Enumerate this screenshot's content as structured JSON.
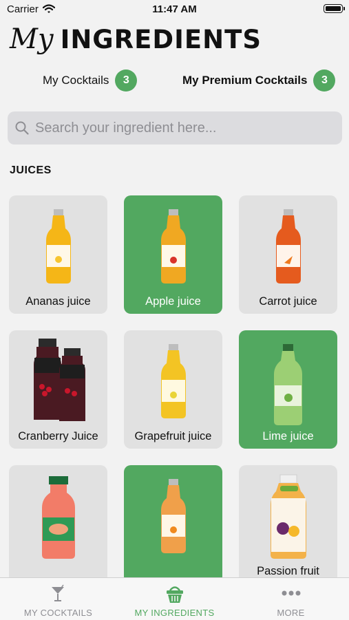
{
  "status_bar": {
    "carrier": "Carrier",
    "time": "11:47 AM"
  },
  "header": {
    "title_script": "My",
    "title_main": "INGREDIENTS"
  },
  "counters": [
    {
      "label": "My Cocktails",
      "count": "3"
    },
    {
      "label": "My Premium Cocktails",
      "count": "3"
    }
  ],
  "search": {
    "placeholder": "Search your ingredient here...",
    "value": ""
  },
  "section_title": "JUICES",
  "ingredients": [
    {
      "name": "Ananas juice",
      "selected": false
    },
    {
      "name": "Apple juice",
      "selected": true
    },
    {
      "name": "Carrot juice",
      "selected": false
    },
    {
      "name": "Cranberry Juice",
      "selected": false
    },
    {
      "name": "Grapefruit juice",
      "selected": false
    },
    {
      "name": "Lime juice",
      "selected": true
    },
    {
      "name": "",
      "selected": false
    },
    {
      "name": "",
      "selected": true
    },
    {
      "name": "Passion fruit",
      "selected": false
    }
  ],
  "tab_bar": {
    "active_color": "#52a860",
    "tabs": [
      {
        "label": "MY COCKTAILS",
        "icon": "cocktail-glass-icon",
        "active": false
      },
      {
        "label": "MY INGREDIENTS",
        "icon": "basket-icon",
        "active": true
      },
      {
        "label": "MORE",
        "icon": "more-dots-icon",
        "active": false
      }
    ]
  }
}
